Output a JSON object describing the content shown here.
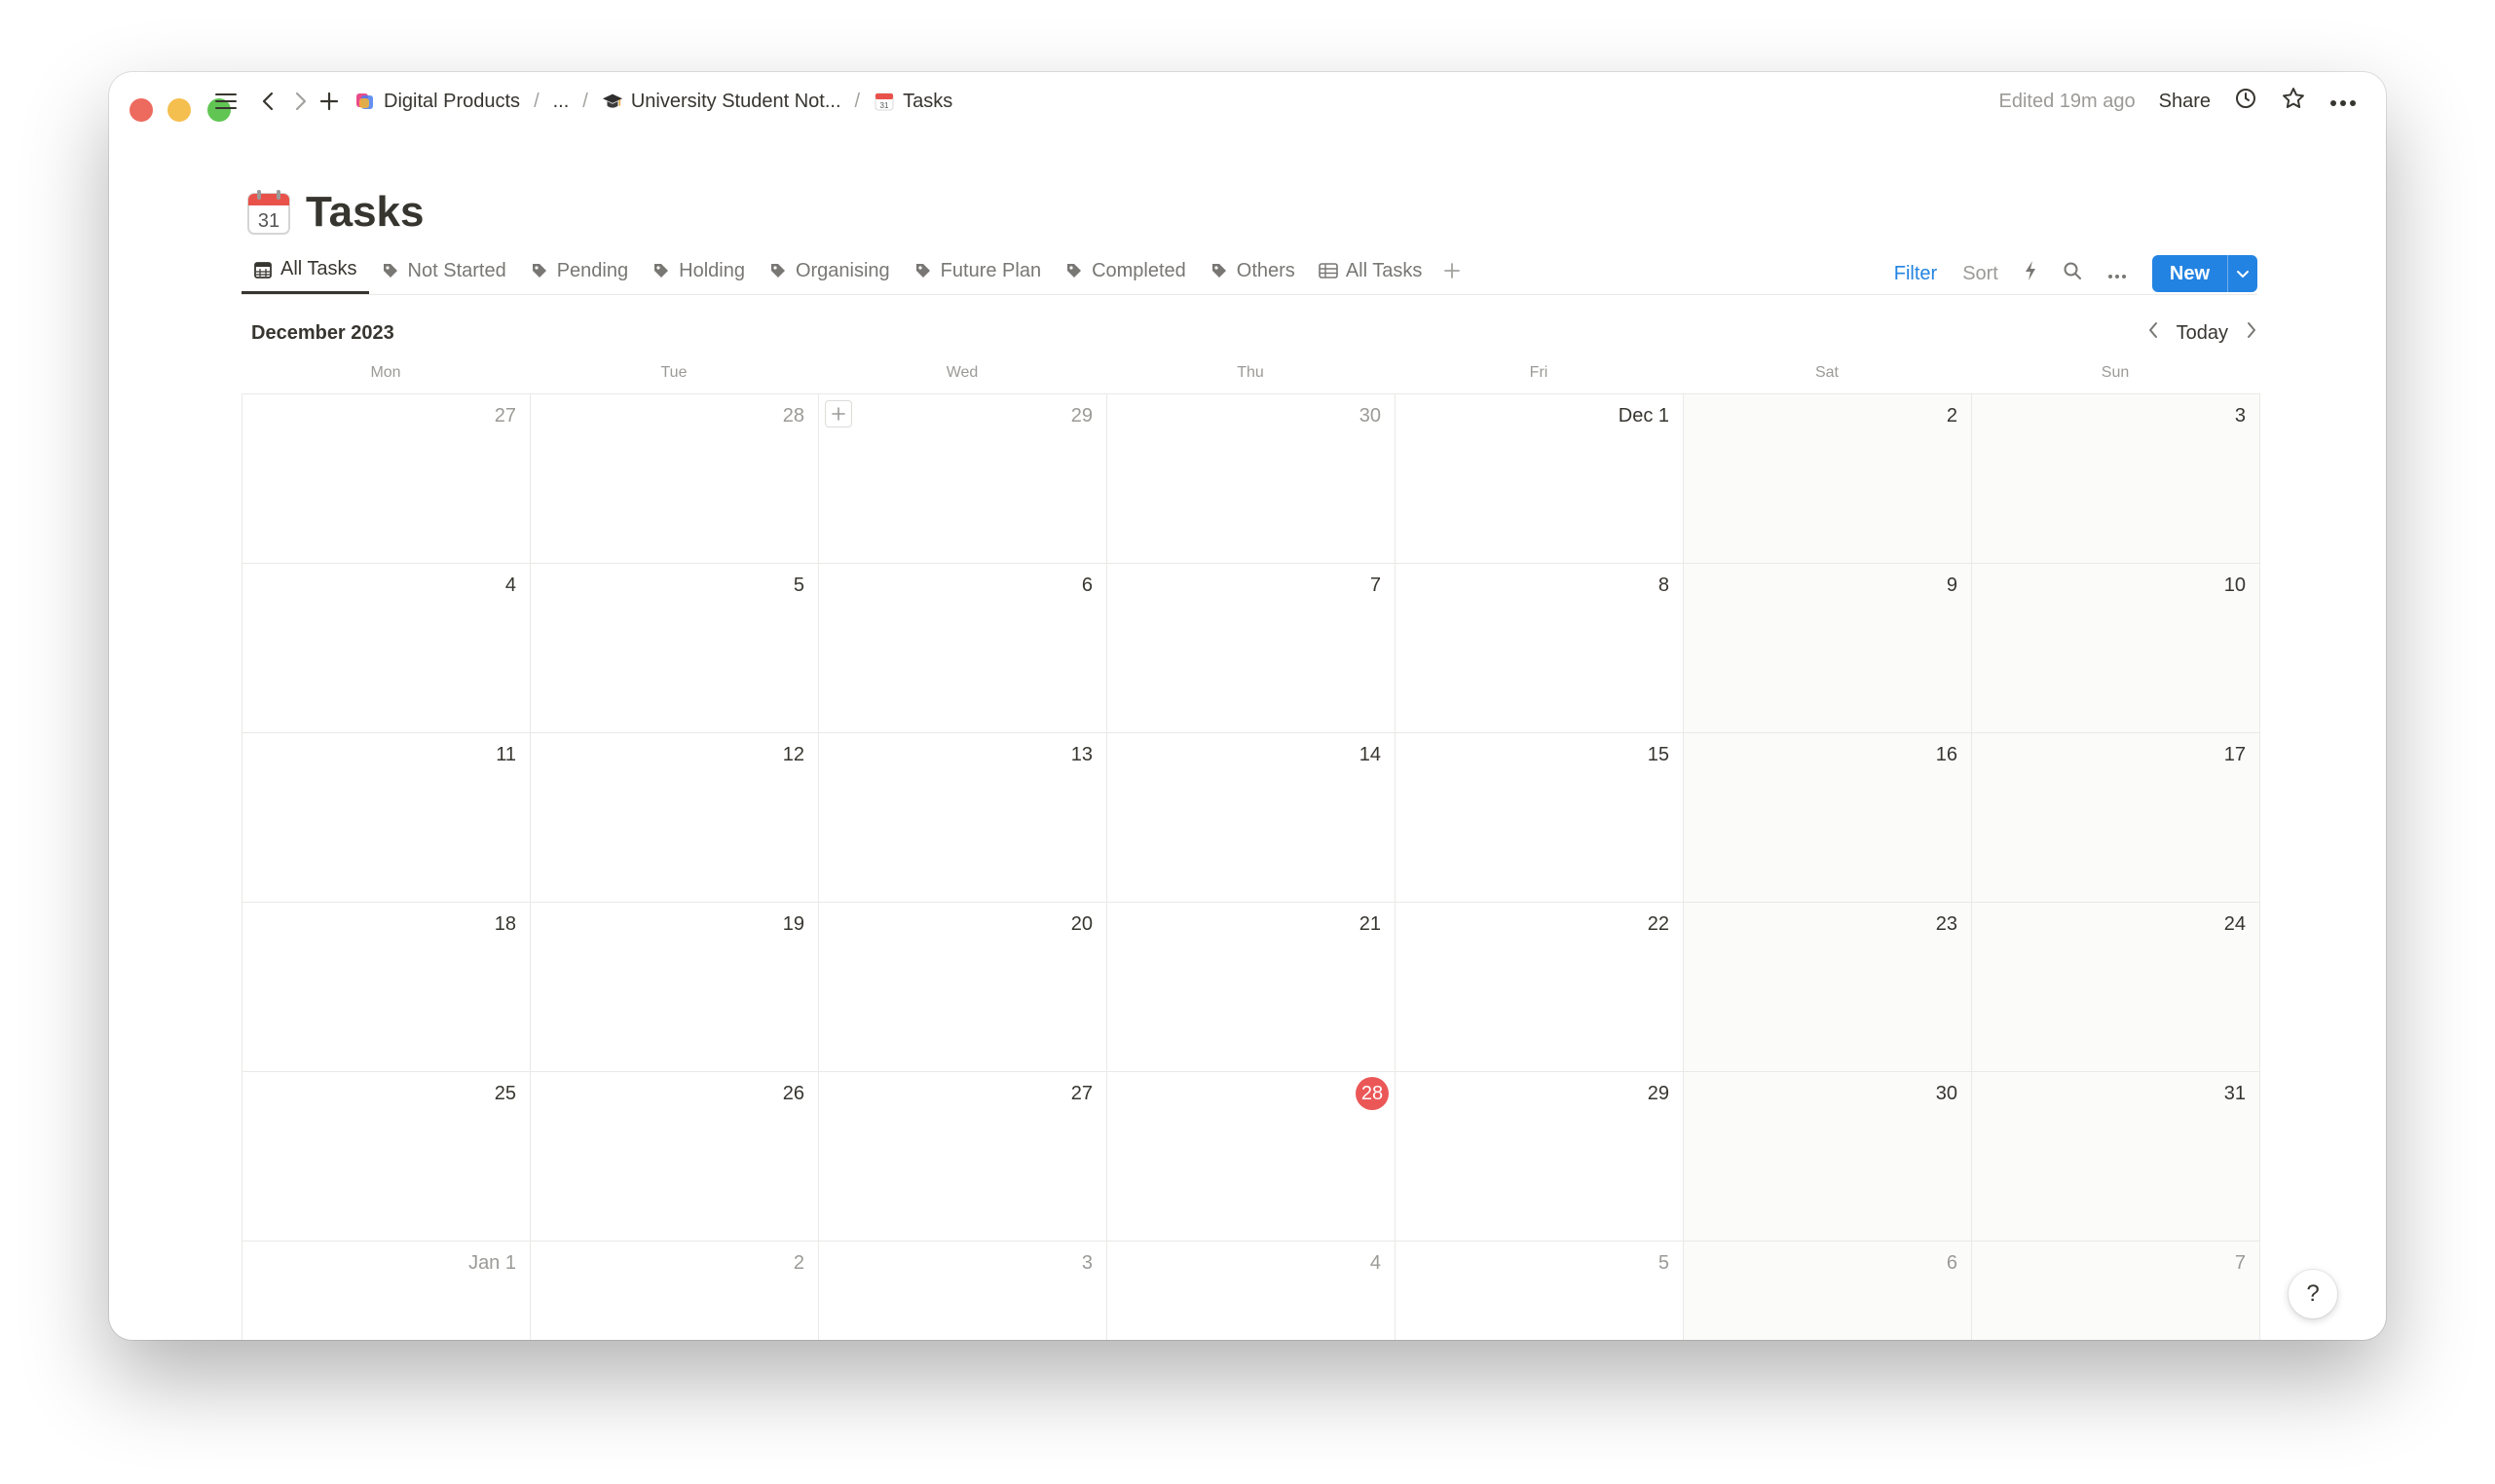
{
  "topbar": {
    "breadcrumbs": [
      {
        "label": "Digital Products",
        "icon": "colorful-logo-icon"
      },
      {
        "label": "..."
      },
      {
        "label": "University Student Not...",
        "icon": "graduation-cap-icon"
      },
      {
        "label": "Tasks",
        "icon": "calendar-icon"
      }
    ],
    "edited": "Edited 19m ago",
    "share": "Share"
  },
  "page": {
    "title": "Tasks",
    "title_icon_day": "31"
  },
  "views": {
    "tabs": [
      {
        "label": "All Tasks",
        "icon": "calendar-grid-icon",
        "active": true
      },
      {
        "label": "Not Started",
        "icon": "tag-icon"
      },
      {
        "label": "Pending",
        "icon": "tag-icon"
      },
      {
        "label": "Holding",
        "icon": "tag-icon"
      },
      {
        "label": "Organising",
        "icon": "tag-icon"
      },
      {
        "label": "Future Plan",
        "icon": "tag-icon"
      },
      {
        "label": "Completed",
        "icon": "tag-icon"
      },
      {
        "label": "Others",
        "icon": "tag-icon"
      },
      {
        "label": "All Tasks",
        "icon": "table-icon"
      }
    ],
    "filter": "Filter",
    "sort": "Sort",
    "new": "New"
  },
  "calendar": {
    "month": "December 2023",
    "today": "Today",
    "weekdays": [
      "Mon",
      "Tue",
      "Wed",
      "Thu",
      "Fri",
      "Sat",
      "Sun"
    ],
    "weeks": [
      [
        {
          "d": "27",
          "m": true
        },
        {
          "d": "28",
          "m": true
        },
        {
          "d": "29",
          "m": true
        },
        {
          "d": "30",
          "m": true
        },
        {
          "d": "Dec 1"
        },
        {
          "d": "2"
        },
        {
          "d": "3"
        }
      ],
      [
        {
          "d": "4"
        },
        {
          "d": "5"
        },
        {
          "d": "6"
        },
        {
          "d": "7"
        },
        {
          "d": "8"
        },
        {
          "d": "9"
        },
        {
          "d": "10"
        }
      ],
      [
        {
          "d": "11"
        },
        {
          "d": "12"
        },
        {
          "d": "13"
        },
        {
          "d": "14"
        },
        {
          "d": "15"
        },
        {
          "d": "16"
        },
        {
          "d": "17"
        }
      ],
      [
        {
          "d": "18"
        },
        {
          "d": "19"
        },
        {
          "d": "20"
        },
        {
          "d": "21"
        },
        {
          "d": "22"
        },
        {
          "d": "23"
        },
        {
          "d": "24"
        }
      ],
      [
        {
          "d": "25"
        },
        {
          "d": "26"
        },
        {
          "d": "27"
        },
        {
          "d": "28",
          "today": true
        },
        {
          "d": "29"
        },
        {
          "d": "30"
        },
        {
          "d": "31"
        }
      ],
      [
        {
          "d": "Jan 1",
          "m": true
        },
        {
          "d": "2",
          "m": true
        },
        {
          "d": "3",
          "m": true
        },
        {
          "d": "4",
          "m": true
        },
        {
          "d": "5",
          "m": true
        },
        {
          "d": "6",
          "m": true
        },
        {
          "d": "7",
          "m": true
        }
      ]
    ]
  },
  "help": "?",
  "colors": {
    "accent": "#2383e2",
    "today": "#eb5757",
    "text": "#37352f",
    "muted": "#9b9a97"
  }
}
